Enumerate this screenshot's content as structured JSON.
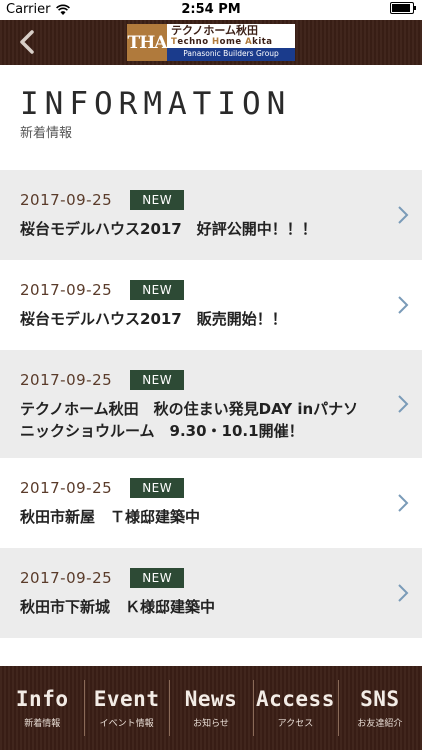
{
  "status_bar": {
    "carrier": "Carrier",
    "time": "2:54 PM",
    "battery_level": 0.9
  },
  "header": {
    "logo": {
      "mark": "THA",
      "jp": "テクノホーム秋田",
      "en_parts": [
        "T",
        "echno ",
        "H",
        "ome ",
        "A",
        "kita"
      ],
      "group": "Panasonic Builders Group"
    }
  },
  "page": {
    "title": "INFORMATION",
    "subtitle": "新着情報"
  },
  "news": [
    {
      "date": "2017-09-25",
      "badge": "NEW",
      "title": "桜台モデルハウス2017　好評公開中！！！"
    },
    {
      "date": "2017-09-25",
      "badge": "NEW",
      "title": "桜台モデルハウス2017　販売開始！！"
    },
    {
      "date": "2017-09-25",
      "badge": "NEW",
      "title": "テクノホーム秋田　秋の住まい発見DAY inパナソニックショウルーム　9.30・10.1開催！"
    },
    {
      "date": "2017-09-25",
      "badge": "NEW",
      "title": "秋田市新屋　Ｔ様邸建築中"
    },
    {
      "date": "2017-09-25",
      "badge": "NEW",
      "title": "秋田市下新城　Ｋ様邸建築中"
    }
  ],
  "tabs": [
    {
      "label": "Info",
      "sub": "新着情報"
    },
    {
      "label": "Event",
      "sub": "イベント情報"
    },
    {
      "label": "News",
      "sub": "お知らせ"
    },
    {
      "label": "Access",
      "sub": "アクセス"
    },
    {
      "label": "SNS",
      "sub": "お友達紹介"
    }
  ]
}
